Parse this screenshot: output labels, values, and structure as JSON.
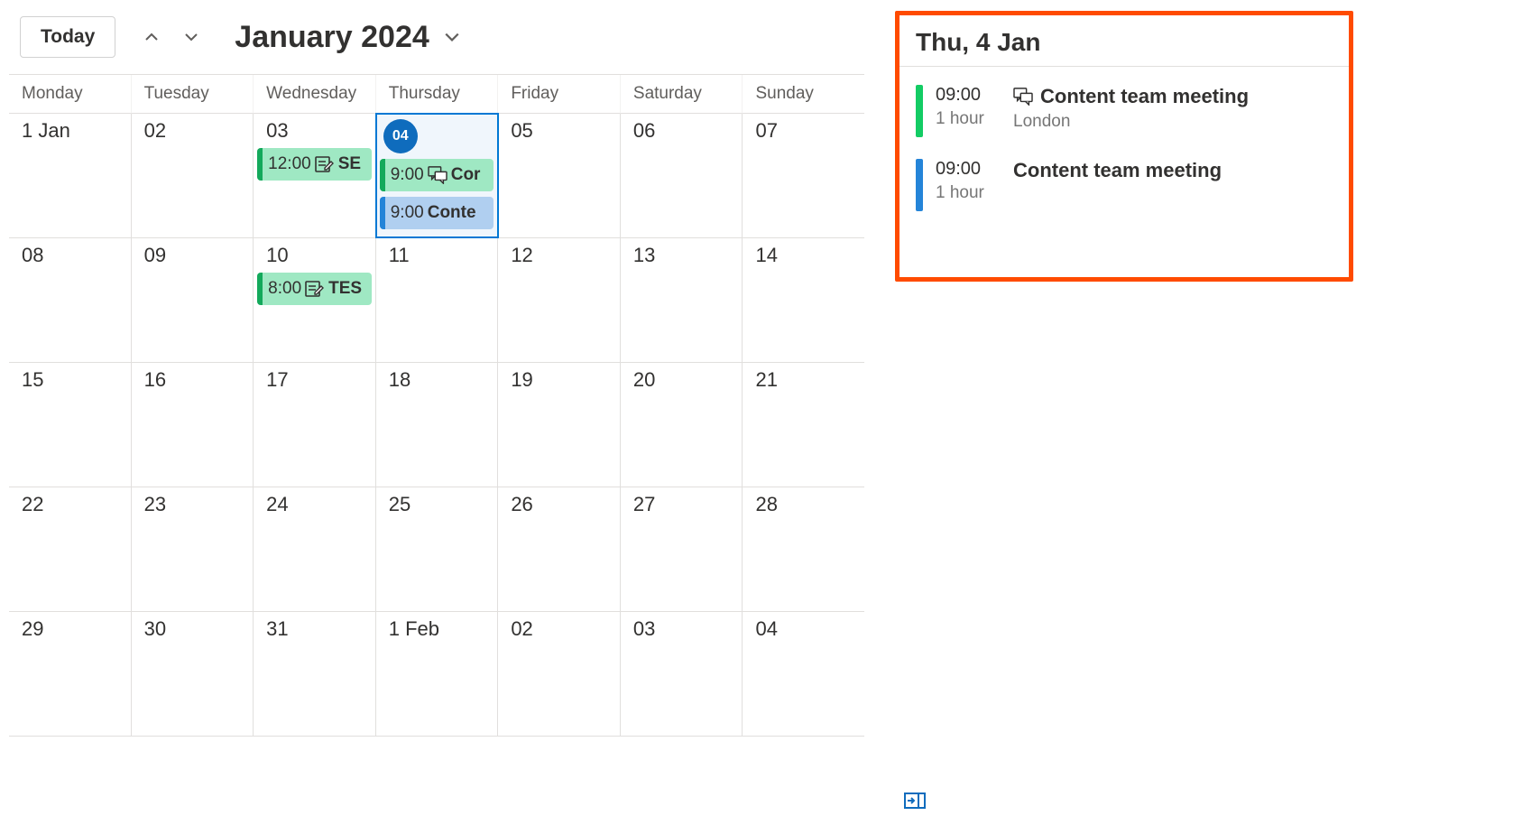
{
  "toolbar": {
    "today_label": "Today",
    "month_label": "January 2024"
  },
  "daynames": [
    "Monday",
    "Tuesday",
    "Wednesday",
    "Thursday",
    "Friday",
    "Saturday",
    "Sunday"
  ],
  "weeks": [
    [
      {
        "label": "1 Jan"
      },
      {
        "label": "02"
      },
      {
        "label": "03",
        "events": [
          {
            "color": "green",
            "time": "12:00",
            "icon": "note",
            "title": "SE"
          }
        ]
      },
      {
        "label": "04",
        "selected": true,
        "events": [
          {
            "color": "green",
            "time": "9:00",
            "icon": "chat",
            "title": "Cor"
          },
          {
            "color": "blue",
            "time": "9:00",
            "title": "Conte"
          }
        ]
      },
      {
        "label": "05"
      },
      {
        "label": "06"
      },
      {
        "label": "07"
      }
    ],
    [
      {
        "label": "08"
      },
      {
        "label": "09"
      },
      {
        "label": "10",
        "events": [
          {
            "color": "green",
            "time": "8:00",
            "icon": "note",
            "title": "TES"
          }
        ]
      },
      {
        "label": "11"
      },
      {
        "label": "12"
      },
      {
        "label": "13"
      },
      {
        "label": "14"
      }
    ],
    [
      {
        "label": "15"
      },
      {
        "label": "16"
      },
      {
        "label": "17"
      },
      {
        "label": "18"
      },
      {
        "label": "19"
      },
      {
        "label": "20"
      },
      {
        "label": "21"
      }
    ],
    [
      {
        "label": "22"
      },
      {
        "label": "23"
      },
      {
        "label": "24"
      },
      {
        "label": "25"
      },
      {
        "label": "26"
      },
      {
        "label": "27"
      },
      {
        "label": "28"
      }
    ],
    [
      {
        "label": "29"
      },
      {
        "label": "30"
      },
      {
        "label": "31"
      },
      {
        "label": "1 Feb"
      },
      {
        "label": "02"
      },
      {
        "label": "03"
      },
      {
        "label": "04"
      }
    ]
  ],
  "side": {
    "header": "Thu, 4 Jan",
    "items": [
      {
        "color": "green",
        "time": "09:00",
        "duration": "1 hour",
        "icon": "chat",
        "title": "Content team meeting",
        "location": "London"
      },
      {
        "color": "blue",
        "time": "09:00",
        "duration": "1 hour",
        "title": "Content team meeting"
      }
    ]
  }
}
